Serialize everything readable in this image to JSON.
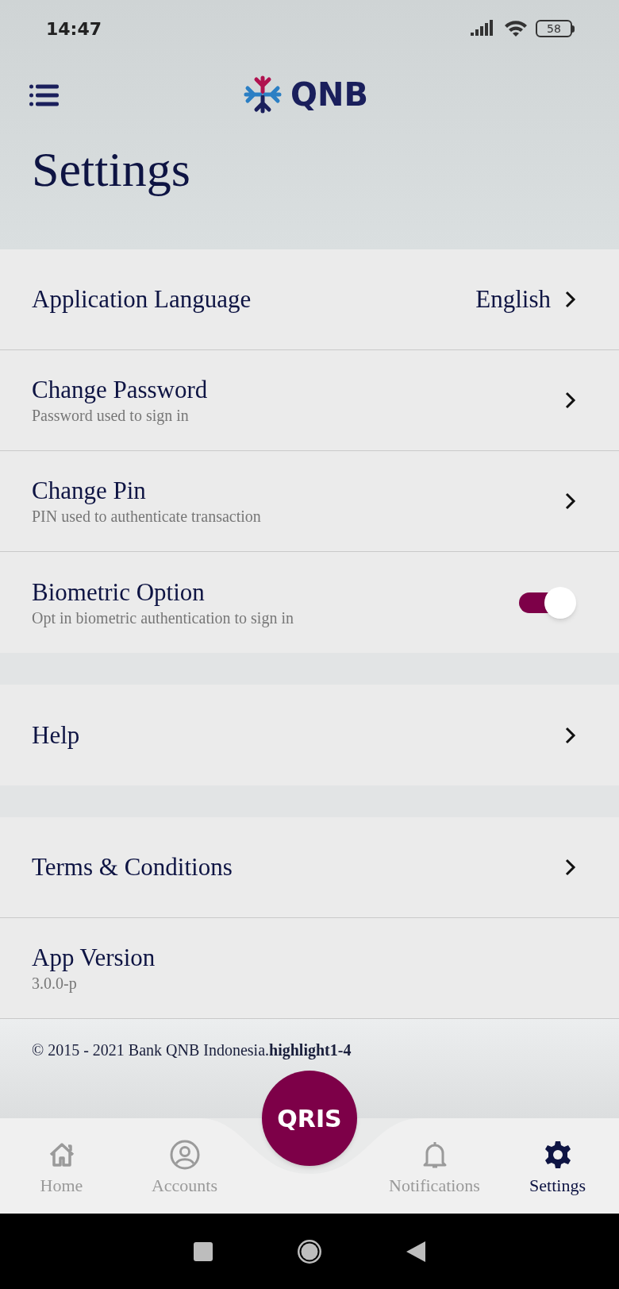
{
  "status_bar": {
    "time": "14:47",
    "battery": "58"
  },
  "header": {
    "logo": "QNB",
    "title": "Settings"
  },
  "sections": [
    [
      {
        "kind": "link",
        "title": "Application Language",
        "value": "English"
      },
      {
        "kind": "link",
        "title": "Change Password",
        "subtitle": "Password used to sign in"
      },
      {
        "kind": "link",
        "title": "Change Pin",
        "subtitle": "PIN used to authenticate transaction"
      },
      {
        "kind": "toggle",
        "title": "Biometric Option",
        "subtitle": "Opt in biometric authentication to sign in",
        "on": true
      }
    ],
    [
      {
        "kind": "link",
        "title": "Help"
      }
    ],
    [
      {
        "kind": "link",
        "title": "Terms & Conditions"
      },
      {
        "kind": "info",
        "title": "App Version",
        "subtitle": "3.0.0-p"
      }
    ]
  ],
  "footer": {
    "text": "© 2015 - 2021 Bank QNB Indonesia.**highlight1-4**"
  },
  "bottom_nav": {
    "center_button": "QRIS",
    "items": [
      {
        "kind": "home",
        "label": "Home",
        "selected": false
      },
      {
        "kind": "accounts",
        "label": "Accounts",
        "selected": false
      },
      {
        "kind": "notifications",
        "label": "Notifications",
        "selected": false
      },
      {
        "kind": "settings",
        "label": "Settings",
        "selected": true
      }
    ]
  }
}
